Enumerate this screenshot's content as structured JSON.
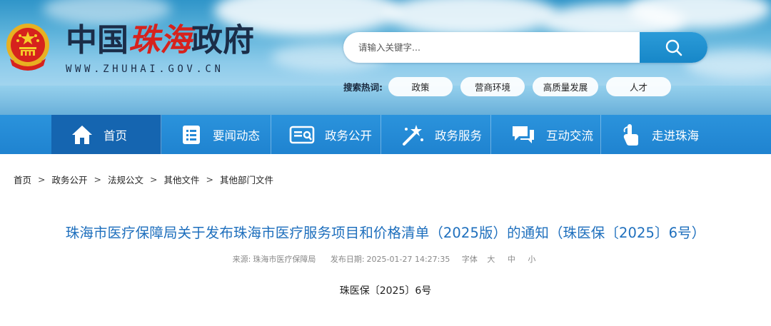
{
  "site": {
    "name_prefix": "中国",
    "name_calligraphy": "珠海",
    "name_suffix": "政府",
    "domain": "WWW.ZHUHAI.GOV.CN"
  },
  "search": {
    "placeholder": "请输入关键字...",
    "button_icon": "search-icon"
  },
  "hot_search": {
    "label": "搜索热词:",
    "tags": [
      "政策",
      "营商环境",
      "高质量发展",
      "人才"
    ]
  },
  "nav": {
    "items": [
      {
        "label": "首页",
        "icon": "home-icon"
      },
      {
        "label": "要闻动态",
        "icon": "news-list-icon"
      },
      {
        "label": "政务公开",
        "icon": "id-card-icon"
      },
      {
        "label": "政务服务",
        "icon": "magic-wand-icon"
      },
      {
        "label": "互动交流",
        "icon": "chat-bubble-icon"
      },
      {
        "label": "走进珠海",
        "icon": "pointer-hand-icon"
      }
    ]
  },
  "breadcrumb": [
    "首页",
    "政务公开",
    "法规公文",
    "其他文件",
    "其他部门文件"
  ],
  "article": {
    "title": "珠海市医疗保障局关于发布珠海市医疗服务项目和价格清单（2025版）的通知（珠医保〔2025〕6号）",
    "source_label": "来源:",
    "source": "珠海市医疗保障局",
    "date_label": "发布日期:",
    "date": "2025-01-27 14:27:35",
    "font_label": "字体",
    "font_large": "大",
    "font_medium": "中",
    "font_small": "小",
    "doc_number": "珠医保〔2025〕6号"
  },
  "colors": {
    "nav_bg": "#2589d6",
    "nav_active": "#1565b0",
    "title_blue": "#1e6fbd",
    "search_button": "#1f8fd2"
  }
}
